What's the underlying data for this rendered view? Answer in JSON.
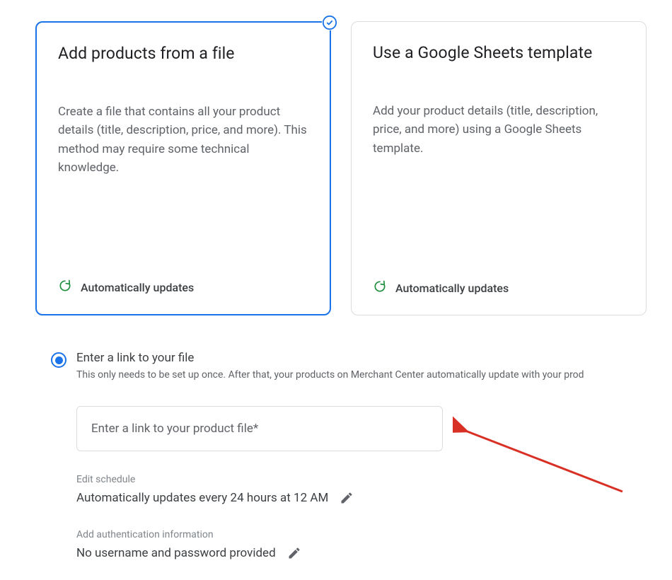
{
  "cards": [
    {
      "title": "Add products from a file",
      "desc": "Create a file that contains all your product details (title, description, price, and more). This method may require some technical knowledge.",
      "footer": "Automatically updates",
      "selected": true
    },
    {
      "title": "Use a Google Sheets template",
      "desc": "Add your product details (title, description, price, and more) using a Google Sheets template.",
      "footer": "Automatically updates",
      "selected": false
    }
  ],
  "radio": {
    "title": "Enter a link to your file",
    "sub": "This only needs to be set up once. After that, your products on Merchant Center automatically update with your prod"
  },
  "input": {
    "placeholder": "Enter a link to your product file*"
  },
  "schedule": {
    "label": "Edit schedule",
    "value": "Automatically updates every 24 hours at 12 AM"
  },
  "auth": {
    "label": "Add authentication information",
    "value": "No username and password provided"
  },
  "colors": {
    "accent_blue": "#1a73e8",
    "green": "#1e8e3e",
    "border": "#dadce0",
    "text_secondary": "#5f6368"
  }
}
